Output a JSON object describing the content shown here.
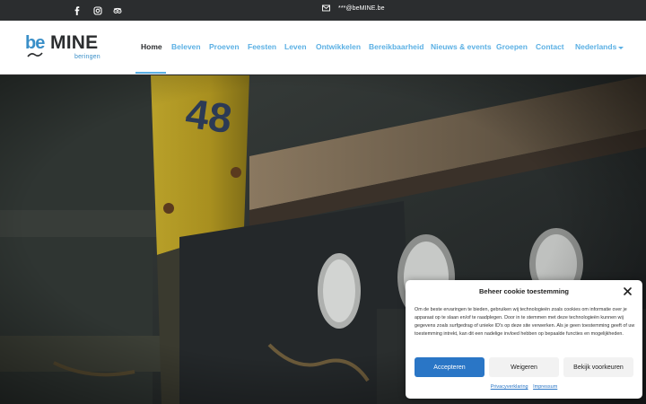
{
  "topbar": {
    "icons": [
      "facebook-icon",
      "instagram-icon",
      "tripadvisor-icon",
      "mail-icon"
    ],
    "email": "***@beMINE.be"
  },
  "logo": {
    "be": "be",
    "mine": "MINE",
    "sub": "beringen"
  },
  "nav": {
    "items": [
      "Home",
      "Beleven",
      "Proeven",
      "Feesten",
      "Leven",
      "Ontwikkelen",
      "Bereikbaarheid",
      "Nieuws & events",
      "Groepen",
      "Contact",
      "Nederlands"
    ],
    "active": "Home"
  },
  "cookie": {
    "title": "Beheer cookie toestemming",
    "body": "Om de beste ervaringen te bieden, gebruiken wij technologieën zoals cookies om informatie over je apparaat op te slaan en/of te raadplegen. Door in te stemmen met deze technologieën kunnen wij gegevens zoals surfgedrag of unieke ID's op deze site verwerken. Als je geen toestemming geeft of uw toestemming intrekt, kan dit een nadelige invloed hebben op bepaalde functies en mogelijkheden.",
    "accept": "Accepteren",
    "deny": "Weigeren",
    "prefs": "Bekijk voorkeuren",
    "privacy": "Privacyverklaring",
    "impressum": "Impressum"
  },
  "hero": {
    "sign_number": "48"
  },
  "colors": {
    "topbar": "#2b2d2f",
    "nav_link": "#5bb0e4",
    "brand_blue": "#3a8fc8",
    "accept_button": "#2a76c6"
  }
}
